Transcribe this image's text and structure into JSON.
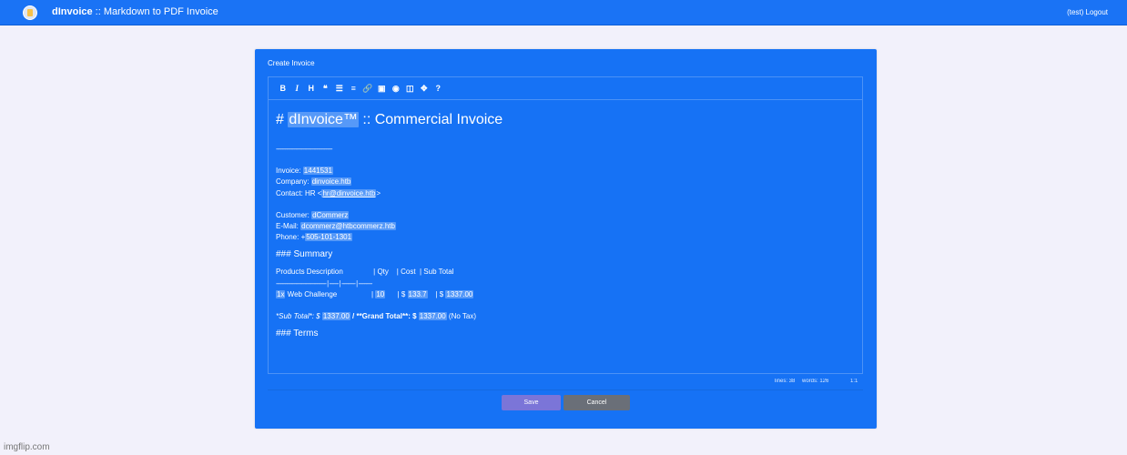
{
  "topbar": {
    "brand_bold": "dInvoice",
    "brand_rest": " :: Markdown to PDF Invoice",
    "logout": "(test) Logout"
  },
  "card": {
    "title": "Create Invoice",
    "toolbar": [
      {
        "glyph": "B",
        "name": "bold-icon"
      },
      {
        "glyph": "I",
        "name": "italic-icon"
      },
      {
        "glyph": "H",
        "name": "heading-icon"
      },
      {
        "glyph": "❝",
        "name": "quote-icon"
      },
      {
        "glyph": "☰",
        "name": "unordered-list-icon"
      },
      {
        "glyph": "≡",
        "name": "ordered-list-icon"
      },
      {
        "glyph": "🔗",
        "name": "link-icon"
      },
      {
        "glyph": "▣",
        "name": "image-icon"
      },
      {
        "glyph": "◉",
        "name": "preview-icon"
      },
      {
        "glyph": "◫",
        "name": "side-by-side-icon"
      },
      {
        "glyph": "✥",
        "name": "fullscreen-icon"
      },
      {
        "glyph": "?",
        "name": "help-icon"
      }
    ],
    "markdown": {
      "h1_prefix": "# ",
      "h1_brand": "dInvoice™",
      "h1_rest": " :: Commercial Invoice",
      "rule": "-------------------------------------",
      "invoice_label": "Invoice: ",
      "invoice_value": "1441531",
      "company_label": "Company: ",
      "company_value": "dinvoice.htb",
      "contact_label": "Contact: HR <",
      "contact_email": "hr@dinvoice.htb",
      "contact_end": ">",
      "customer_label": "Customer: ",
      "customer_value": "dCommerz",
      "email_label": "E-Mail: ",
      "email_value": "dcommerz@htbcommerz.htb",
      "phone_label": "Phone: +",
      "phone_value": "505-101-1301",
      "summary_heading": "### Summary",
      "table_header": "Products Description               | Qty    | Cost  | Sub Total",
      "table_sep": "--------------------------------- | ------ | --------- | ---------",
      "row_qty_prefix": "1x",
      "row_desc": " Web Challenge                 | ",
      "row_qty": "10",
      "row_cost_prefix": "      | $ ",
      "row_cost": "133.7",
      "row_sub_prefix": "    | $ ",
      "row_sub": "1337.00",
      "subtotal_label": "*Sub Total*: $ ",
      "subtotal_value": "1337.00",
      "grand_label": " / **Grand Total**: $ ",
      "grand_value": "1337.00",
      "grand_suffix": " (No Tax)",
      "terms_heading": "### Terms"
    },
    "status": {
      "lines": "lines: 38",
      "words": "words: 126",
      "cursor": "1:1"
    },
    "save_label": "Save",
    "cancel_label": "Cancel"
  },
  "watermark": "imgflip.com"
}
